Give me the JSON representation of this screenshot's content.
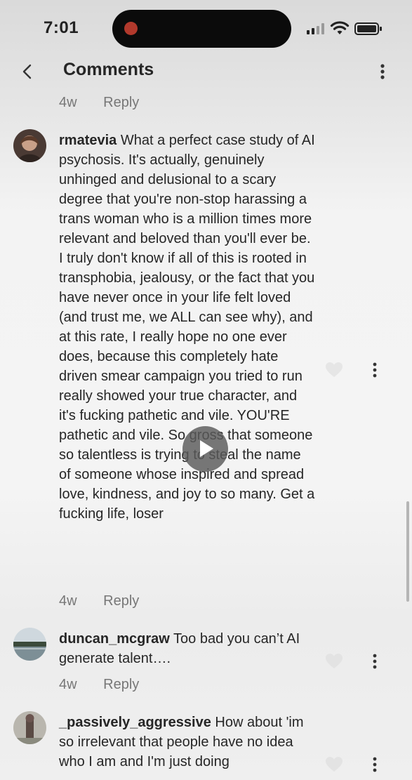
{
  "status_bar": {
    "time": "7:01"
  },
  "header": {
    "title": "Comments"
  },
  "previous_comment_meta": {
    "age": "4w",
    "reply_label": "Reply"
  },
  "comments": [
    {
      "username": "rmatevia",
      "text": "What a perfect case study of AI psychosis. It's actually, genuinely unhinged and delusional to a scary degree that you're non-stop harassing a trans woman who is a million times more relevant and beloved than you'll ever be. I truly don't know if all of this is rooted in transphobia, jealousy, or the fact that you have never once in your life felt loved (and trust me, we ALL can see why), and at this rate, I really hope no one ever does, because this completely hate driven smear campaign you tried to run really showed your true character, and it's fucking pathetic and vile. YOU'RE pathetic and vile. So gross that someone so talentless is trying to steal the name of someone whose inspired and spread love, kindness, and joy to so many. Get a fucking life, loser",
      "age": "4w",
      "reply_label": "Reply"
    },
    {
      "username": "duncan_mcgraw",
      "text": "Too bad you can’t AI generate talent….",
      "age": "4w",
      "reply_label": "Reply"
    },
    {
      "username": "_passively_aggressive",
      "text": "How about 'im so irrelevant that people have no idea who I am and I'm just doing"
    }
  ],
  "icons": {
    "back": "chevron-left-icon",
    "more": "vertical-ellipsis-icon",
    "like": "heart-icon",
    "play": "play-icon"
  },
  "colors": {
    "text": "#262626",
    "meta": "#777777",
    "island": "#0b0b0b",
    "island_dot": "#b2392c"
  }
}
